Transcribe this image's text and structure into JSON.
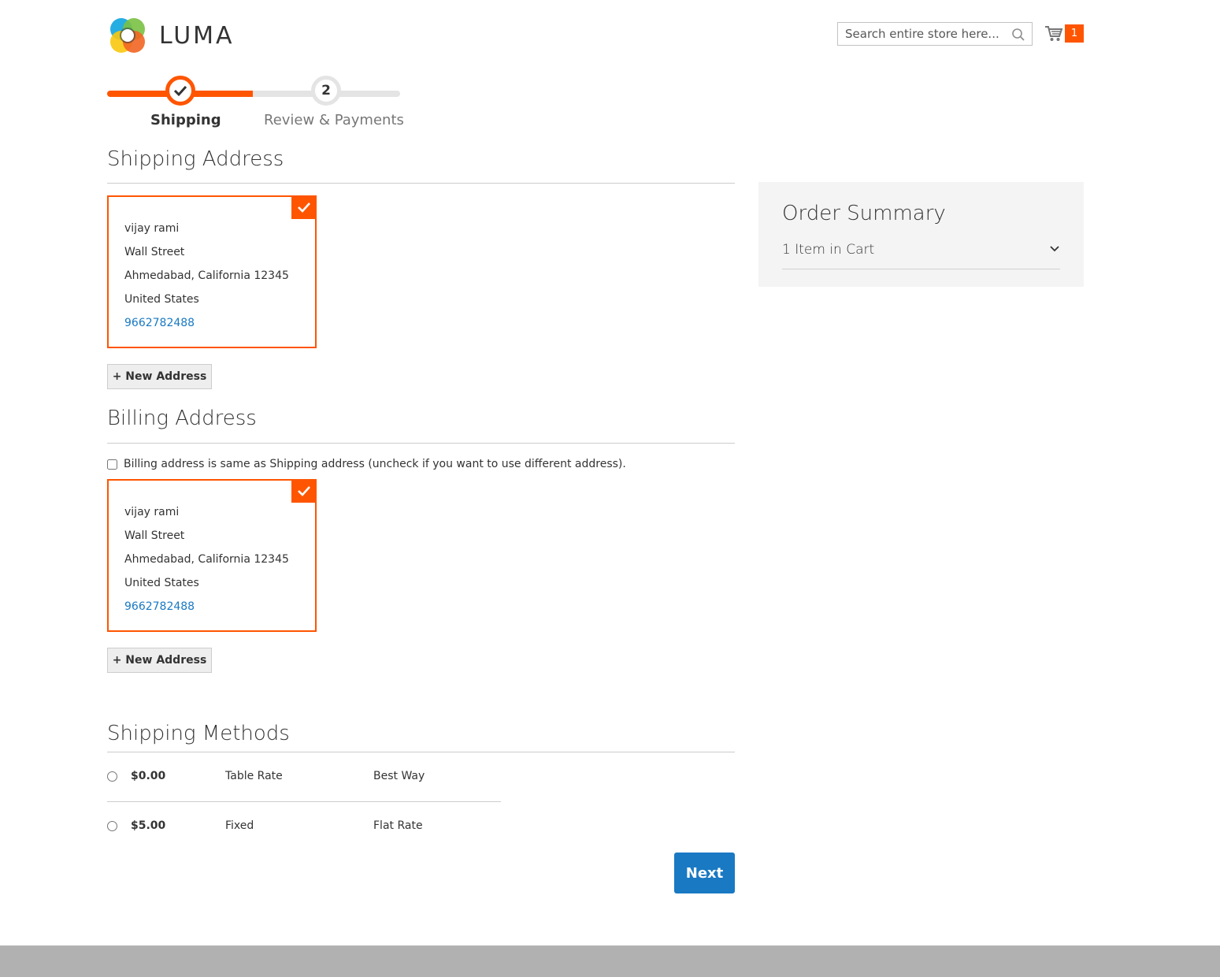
{
  "header": {
    "logo_text": "LUMA",
    "search_placeholder": "Search entire store here...",
    "cart_count": "1"
  },
  "progress": {
    "steps": [
      {
        "label": "Shipping",
        "number": "1",
        "status": "complete"
      },
      {
        "label": "Review & Payments",
        "number": "2",
        "status": "pending"
      }
    ]
  },
  "shipping_address": {
    "title": "Shipping Address",
    "address": {
      "name": "vijay rami",
      "street": "Wall Street",
      "city_line": "Ahmedabad, California 12345",
      "country": "United States",
      "phone": "9662782488"
    },
    "new_address_label": "+ New Address"
  },
  "billing_address": {
    "title": "Billing Address",
    "same_as_shipping_label": "Billing address is same as Shipping address (uncheck if you want to use different address).",
    "same_as_shipping_checked": false,
    "address": {
      "name": "vijay rami",
      "street": "Wall Street",
      "city_line": "Ahmedabad, California 12345",
      "country": "United States",
      "phone": "9662782488"
    },
    "new_address_label": "+ New Address"
  },
  "shipping_methods": {
    "title": "Shipping Methods",
    "methods": [
      {
        "price": "$0.00",
        "method": "Table Rate",
        "carrier": "Best Way"
      },
      {
        "price": "$5.00",
        "method": "Fixed",
        "carrier": "Flat Rate"
      }
    ]
  },
  "order_summary": {
    "title": "Order Summary",
    "items_in_cart": "1 Item in Cart"
  },
  "actions": {
    "next_label": "Next"
  },
  "colors": {
    "accent": "#ff5501",
    "primary_button": "#1979c3",
    "link": "#1979c3"
  }
}
